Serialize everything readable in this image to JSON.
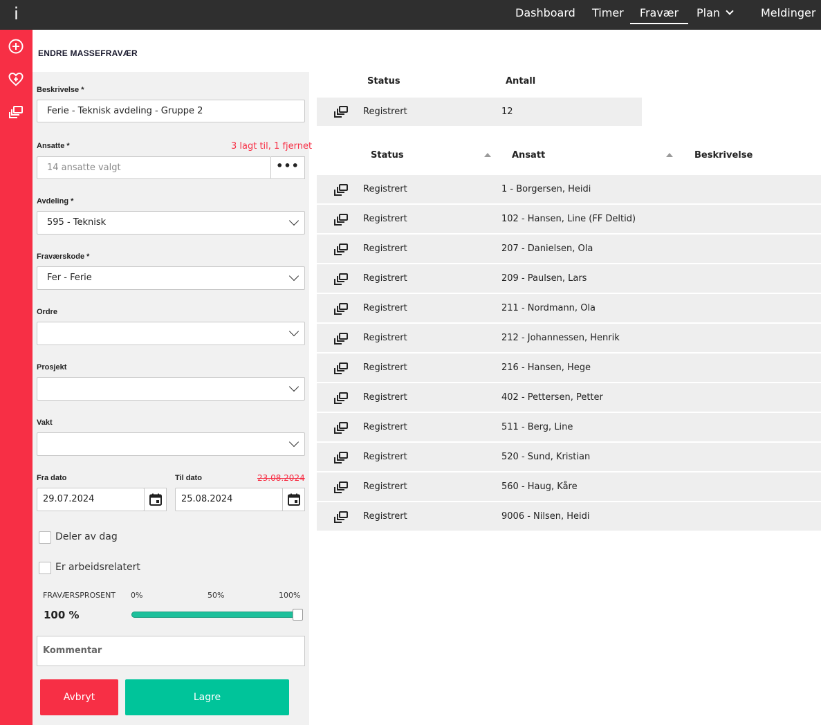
{
  "topbar": {
    "logo": "i",
    "nav": [
      "Dashboard",
      "Timer",
      "Fravær",
      "Plan",
      "Meldinger"
    ],
    "active": "Fravær"
  },
  "sidebar": {
    "icons": [
      "plus-circle-icon",
      "heart-plus-icon",
      "stack-icon"
    ]
  },
  "page_title": "ENDRE MASSEFRAVÆR",
  "form": {
    "beskrivelse_label": "Beskrivelse *",
    "beskrivelse_value": "Ferie - Teknisk avdeling - Gruppe 2",
    "ansatte_label": "Ansatte *",
    "ansatte_note": "3 lagt til, 1 fjernet",
    "ansatte_placeholder": "14 ansatte valgt",
    "dots": "•••",
    "avdeling_label": "Avdeling *",
    "avdeling_value": "595 - Teknisk",
    "fravaerskode_label": "Fraværskode *",
    "fravaerskode_value": "Fer - Ferie",
    "ordre_label": "Ordre",
    "ordre_value": "",
    "prosjekt_label": "Prosjekt",
    "prosjekt_value": "",
    "vakt_label": "Vakt",
    "vakt_value": "",
    "fra_dato_label": "Fra dato",
    "fra_dato_value": "29.07.2024",
    "til_dato_label": "Til dato",
    "til_dato_old": "23.08.2024",
    "til_dato_value": "25.08.2024",
    "deler_av_dag": "Deler av dag",
    "arbeidsrelatert": "Er arbeidsrelatert",
    "fravaersprosent_label": "FRAVÆRSPROSENT",
    "fravaersprosent_value": "100 %",
    "fravaersprosent_level": 1.0,
    "scale_0": "0%",
    "scale_50": "50%",
    "scale_100": "100%",
    "kommentar_placeholder": "Kommentar",
    "cancel_label": "Avbryt",
    "save_label": "Lagre"
  },
  "summary": {
    "headers": [
      "Status",
      "Antall"
    ],
    "row": {
      "status": "Registrert",
      "count": "12"
    }
  },
  "table": {
    "headers": [
      "Status",
      "Ansatt",
      "Beskrivelse"
    ],
    "rows": [
      {
        "status": "Registrert",
        "ansatt": "1 - Borgersen, Heidi"
      },
      {
        "status": "Registrert",
        "ansatt": "102 - Hansen, Line (FF Deltid)"
      },
      {
        "status": "Registrert",
        "ansatt": "207 - Danielsen, Ola"
      },
      {
        "status": "Registrert",
        "ansatt": "209 - Paulsen, Lars"
      },
      {
        "status": "Registrert",
        "ansatt": "211 - Nordmann, Ola"
      },
      {
        "status": "Registrert",
        "ansatt": "212 - Johannessen, Henrik"
      },
      {
        "status": "Registrert",
        "ansatt": "216 - Hansen, Hege"
      },
      {
        "status": "Registrert",
        "ansatt": "402 - Pettersen, Petter"
      },
      {
        "status": "Registrert",
        "ansatt": "511 - Berg, Line"
      },
      {
        "status": "Registrert",
        "ansatt": "520 - Sund, Kristian"
      },
      {
        "status": "Registrert",
        "ansatt": "560 - Haug, Kåre"
      },
      {
        "status": "Registrert",
        "ansatt": "9006 - Nilsen, Heidi"
      }
    ]
  },
  "colors": {
    "brand_red": "#f72f45",
    "accent_green": "#00c49a",
    "topbar": "#2f2f2f"
  }
}
